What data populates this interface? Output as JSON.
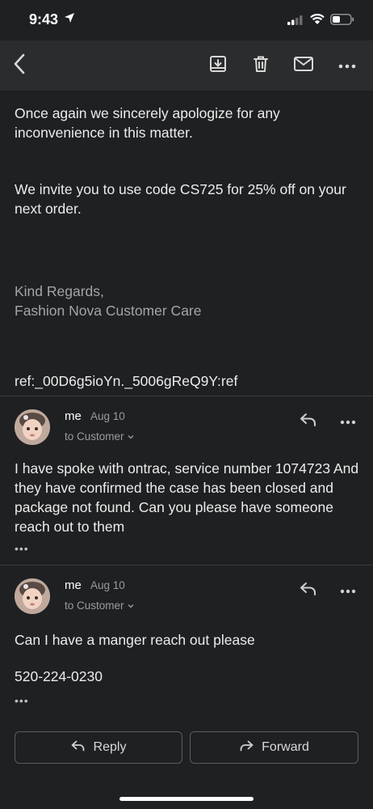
{
  "status_bar": {
    "time": "9:43"
  },
  "toolbar": {
    "back_icon": "chevron-left-icon",
    "archive_icon": "archive-icon",
    "delete_icon": "trash-icon",
    "mark_unread_icon": "mail-icon",
    "more_icon": "more-horizontal-icon"
  },
  "quoted_message": {
    "paragraphs": [
      "Once again we sincerely apologize for any inconvenience in this matter.",
      "We invite you to use code CS725 for 25% off on your next order.",
      "Kind Regards,",
      "Fashion Nova Customer Care",
      "ref:_00D6g5ioYn._5006gReQ9Y:ref"
    ]
  },
  "messages": [
    {
      "sender": "me",
      "date": "Aug 10",
      "recipient": "to Customer",
      "body": "I have spoke with ontrac, service number 1074723 And they have confirmed the case has been closed and package not found. Can you please have someone reach out to them",
      "ellipsis": "•••"
    },
    {
      "sender": "me",
      "date": "Aug 10",
      "recipient": "to Customer",
      "body_lines": [
        "Can I have a manger reach out please",
        "520-224-0230"
      ],
      "ellipsis": "•••"
    }
  ],
  "actions": {
    "reply_label": "Reply",
    "forward_label": "Forward"
  },
  "colors": {
    "background": "#1f2022",
    "toolbar": "#2b2c2e",
    "text": "#ececec",
    "muted": "#a4a5a8"
  }
}
